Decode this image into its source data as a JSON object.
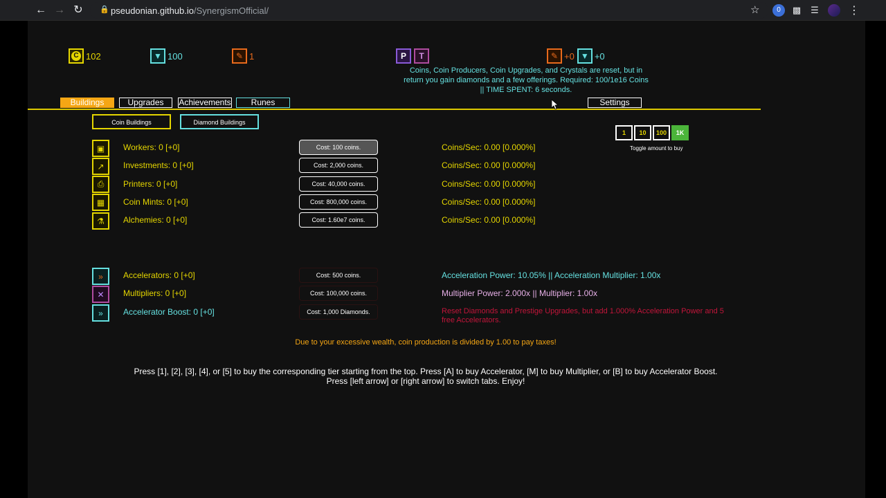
{
  "browser": {
    "url_host": "pseudonian.github.io",
    "url_path": "/SynergismOfficial/",
    "ext_badge": "0"
  },
  "resources": {
    "coins": "102",
    "diamonds": "100",
    "offerings": "1",
    "offerings_gain": "+0",
    "diamonds_gain": "+0",
    "prestige_letter": "P",
    "transcend_letter": "T"
  },
  "reset_info": {
    "line1": "Coins, Coin Producers, Coin Upgrades, and Crystals are reset, but in",
    "line2": "return you gain diamonds and a few offerings. Required: 100/1e16 Coins",
    "line3": "|| TIME SPENT: 6 seconds."
  },
  "tabs": {
    "buildings": "Buildings",
    "upgrades": "Upgrades",
    "achievements": "Achievements",
    "runes": "Runes",
    "settings": "Settings"
  },
  "subtabs": {
    "coin": "Coin Buildings",
    "diamond": "Diamond Buildings"
  },
  "buildings": [
    {
      "name": "Workers: 0 [+0]",
      "cost": "Cost: 100 coins.",
      "rate": "Coins/Sec: 0.00 [0.000%]"
    },
    {
      "name": "Investments: 0 [+0]",
      "cost": "Cost: 2,000 coins.",
      "rate": "Coins/Sec: 0.00 [0.000%]"
    },
    {
      "name": "Printers: 0 [+0]",
      "cost": "Cost: 40,000 coins.",
      "rate": "Coins/Sec: 0.00 [0.000%]"
    },
    {
      "name": "Coin Mints: 0 [+0]",
      "cost": "Cost: 800,000 coins.",
      "rate": "Coins/Sec: 0.00 [0.000%]"
    },
    {
      "name": "Alchemies: 0 [+0]",
      "cost": "Cost: 1.60e7 coins.",
      "rate": "Coins/Sec: 0.00 [0.000%]"
    }
  ],
  "specials": [
    {
      "name": "Accelerators: 0 [+0]",
      "cost": "Cost: 500 coins.",
      "info": "Acceleration Power: 10.05% || Acceleration Multiplier: 1.00x"
    },
    {
      "name": "Multipliers: 0 [+0]",
      "cost": "Cost: 100,000 coins.",
      "info": "Multiplier Power: 2.000x || Multiplier: 1.00x"
    },
    {
      "name": "Accelerator Boost: 0 [+0]",
      "cost": "Cost: 1,000 Diamonds.",
      "info_line1": "Reset Diamonds and Prestige Upgrades, but add 1.000% Acceleration Power and 5",
      "info_line2": "free Accelerators."
    }
  ],
  "buy_amounts": [
    "1",
    "10",
    "100",
    "1K"
  ],
  "buy_amount_label": "Toggle amount to buy",
  "tax_text": "Due to your excessive wealth, coin production is divided by 1.00 to pay taxes!",
  "help": {
    "line1": "Press [1], [2], [3], [4], or [5] to buy the corresponding tier starting from the top. Press [A] to buy Accelerator, [M] to buy Multiplier, or [B] to buy Accelerator Boost.",
    "line2": "Press [left arrow] or [right arrow] to switch tabs. Enjoy!"
  },
  "colors": {
    "coin_yellow": "#e5d600",
    "diamond_cyan": "#65e0e0",
    "accent_orange": "#f5a614",
    "multiplier_pink": "#e8b0e8",
    "boost_red": "#c2153a",
    "buy_active_green": "#4bb53a"
  }
}
